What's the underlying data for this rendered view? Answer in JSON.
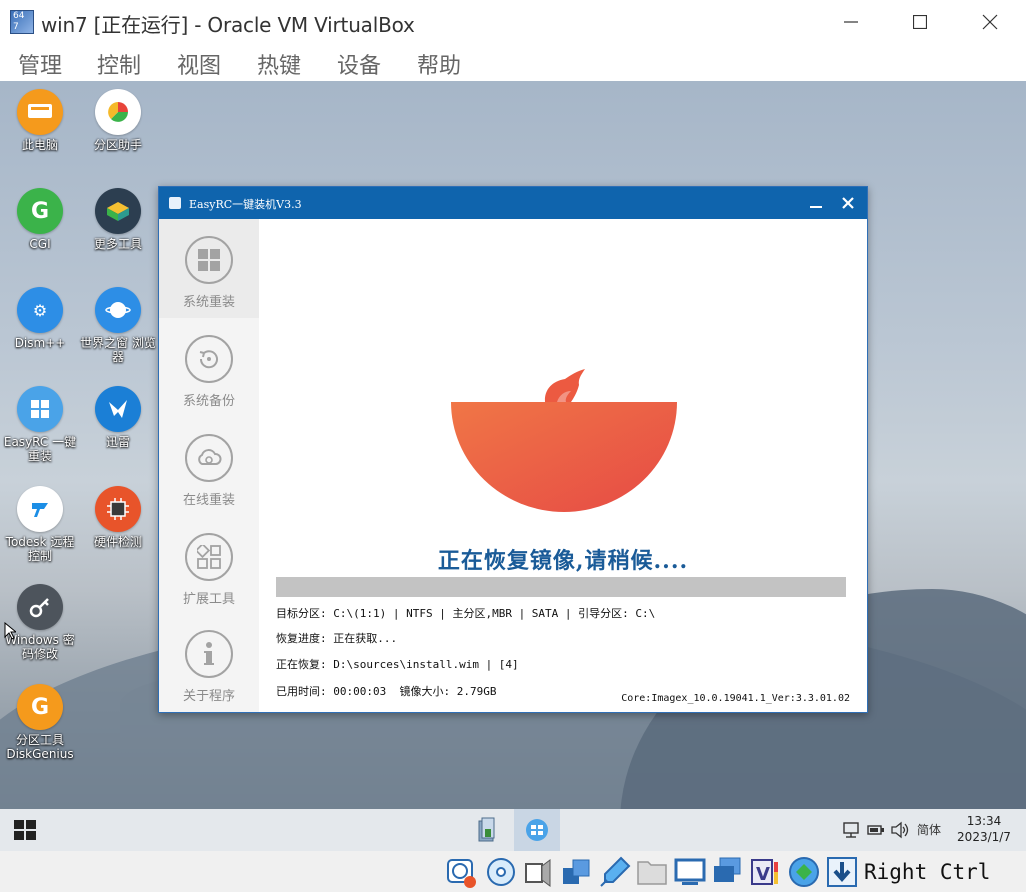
{
  "host": {
    "icon_text": "64\n7",
    "title": "win7 [正在运行] - Oracle VM VirtualBox",
    "menu": [
      "管理",
      "控制",
      "视图",
      "热键",
      "设备",
      "帮助"
    ],
    "host_key": "Right Ctrl"
  },
  "desktop_icons": [
    {
      "label": "此电脑",
      "color": "#f59a1c",
      "glyph": "▭"
    },
    {
      "label": "分区助手",
      "color": "#ffffff",
      "glyph": "◕"
    },
    {
      "label": "CGI",
      "color": "#3bb34a",
      "glyph": "G"
    },
    {
      "label": "更多工具",
      "color": "#2c3e50",
      "glyph": "▣"
    },
    {
      "label": "Dism++",
      "color": "#2d8ee6",
      "glyph": "⚙"
    },
    {
      "label": "世界之窗 浏览器",
      "color": "#2d8ee6",
      "glyph": "◉"
    },
    {
      "label": "EasyRC 一键重装",
      "color": "#4aa3e8",
      "glyph": "⊞"
    },
    {
      "label": "迅雷",
      "color": "#1b7fd6",
      "glyph": "✈"
    },
    {
      "label": "Todesk 远程控制",
      "color": "#ffffff",
      "glyph": "⧉"
    },
    {
      "label": "硬件检测",
      "color": "#e8542a",
      "glyph": "▦"
    },
    {
      "label": "Windows 密码修改",
      "color": "#4d545c",
      "glyph": "⚷"
    },
    {
      "label": "分区工具 DiskGenius",
      "color": "#f59a1c",
      "glyph": "G"
    }
  ],
  "dialog": {
    "title": "EasyRC一键装机V3.3",
    "sidebar": [
      {
        "label": "系统重装",
        "icon": "windows-icon"
      },
      {
        "label": "系统备份",
        "icon": "backup-icon"
      },
      {
        "label": "在线重装",
        "icon": "cloud-icon"
      },
      {
        "label": "扩展工具",
        "icon": "apps-icon"
      },
      {
        "label": "关于程序",
        "icon": "info-icon"
      }
    ],
    "status_message": "正在恢复镜像,请稍候....",
    "progress_fraction": 0,
    "info": {
      "target": "目标分区: C:\\(1:1) | NTFS | 主分区,MBR | SATA | 引导分区: C:\\",
      "progress": "恢复进度: 正在获取...",
      "restoring": "正在恢复: D:\\sources\\install.wim | [4]",
      "elapsed": "已用时间: 00:00:03  镜像大小: 2.79GB",
      "core": "Core:Imagex_10.0.19041.1_Ver:3.3.01.02"
    }
  },
  "taskbar": {
    "ime": "简体",
    "time": "13:34",
    "date": "2023/1/7"
  },
  "colors": {
    "dialog_titlebar": "#0f64ad",
    "status_text": "#1a5b98",
    "logo": "#ec5c44"
  }
}
